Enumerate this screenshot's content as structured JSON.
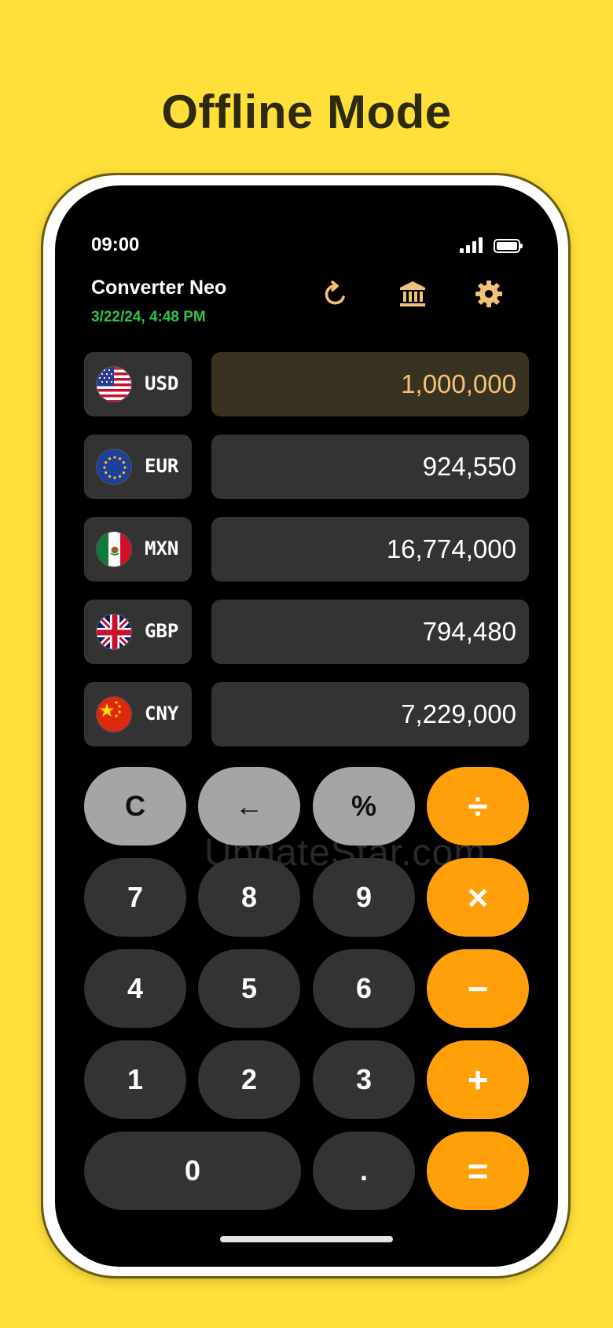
{
  "headline": "Offline Mode",
  "status": {
    "time": "09:00"
  },
  "app": {
    "title": "Converter Neo",
    "updated": "3/22/24, 4:48 PM"
  },
  "icons": {
    "refresh": "refresh-icon",
    "bank": "bank-icon",
    "settings": "gear-icon"
  },
  "rows": [
    {
      "code": "USD",
      "value": "1,000,000",
      "flag": "us-flag-icon",
      "active": true
    },
    {
      "code": "EUR",
      "value": "924,550",
      "flag": "eu-flag-icon"
    },
    {
      "code": "MXN",
      "value": "16,774,000",
      "flag": "mx-flag-icon"
    },
    {
      "code": "GBP",
      "value": "794,480",
      "flag": "gb-flag-icon"
    },
    {
      "code": "CNY",
      "value": "7,229,000",
      "flag": "cn-flag-icon"
    }
  ],
  "keys": {
    "clear": "C",
    "back": "←",
    "percent": "%",
    "divide": "÷",
    "seven": "7",
    "eight": "8",
    "nine": "9",
    "multiply": "×",
    "four": "4",
    "five": "5",
    "six": "6",
    "minus": "−",
    "one": "1",
    "two": "2",
    "three": "3",
    "plus": "+",
    "zero": "0",
    "dot": ".",
    "equals": "="
  },
  "watermark": "UpdateStar.com",
  "colors": {
    "background": "#FFE03A",
    "accent": "#ff9f0a",
    "date_green": "#2ec44a",
    "active_value": "#f2c278"
  }
}
